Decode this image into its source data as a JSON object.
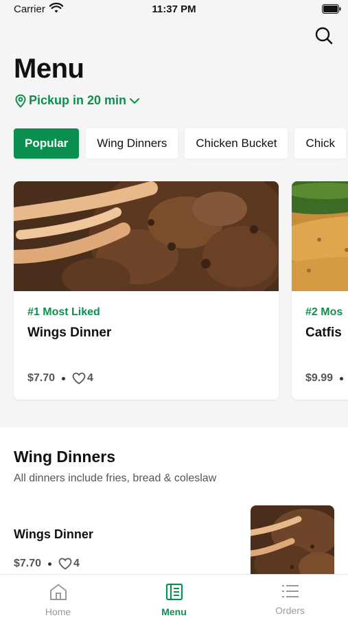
{
  "status_bar": {
    "carrier": "Carrier",
    "time": "11:37 PM"
  },
  "header": {
    "title": "Menu",
    "pickup_label": "Pickup in 20 min"
  },
  "categories": [
    {
      "label": "Popular",
      "active": true
    },
    {
      "label": "Wing Dinners",
      "active": false
    },
    {
      "label": "Chicken Bucket",
      "active": false
    },
    {
      "label": "Chick",
      "active": false
    }
  ],
  "popular_cards": [
    {
      "rank": "#1 Most Liked",
      "name": "Wings Dinner",
      "price": "$7.70",
      "likes": "4"
    },
    {
      "rank": "#2 Mos",
      "name": "Catfis",
      "price": "$9.99",
      "likes": ""
    }
  ],
  "section": {
    "title": "Wing Dinners",
    "subtitle": "All dinners include fries, bread & coleslaw",
    "items": [
      {
        "name": "Wings Dinner",
        "price": "$7.70",
        "likes": "4"
      }
    ]
  },
  "tab_bar": {
    "tabs": [
      {
        "label": "Home",
        "icon": "home-icon",
        "active": false
      },
      {
        "label": "Menu",
        "icon": "menu-book-icon",
        "active": true
      },
      {
        "label": "Orders",
        "icon": "list-icon",
        "active": false
      }
    ]
  },
  "colors": {
    "accent": "#0b8f4f",
    "background": "#f5f5f5"
  }
}
